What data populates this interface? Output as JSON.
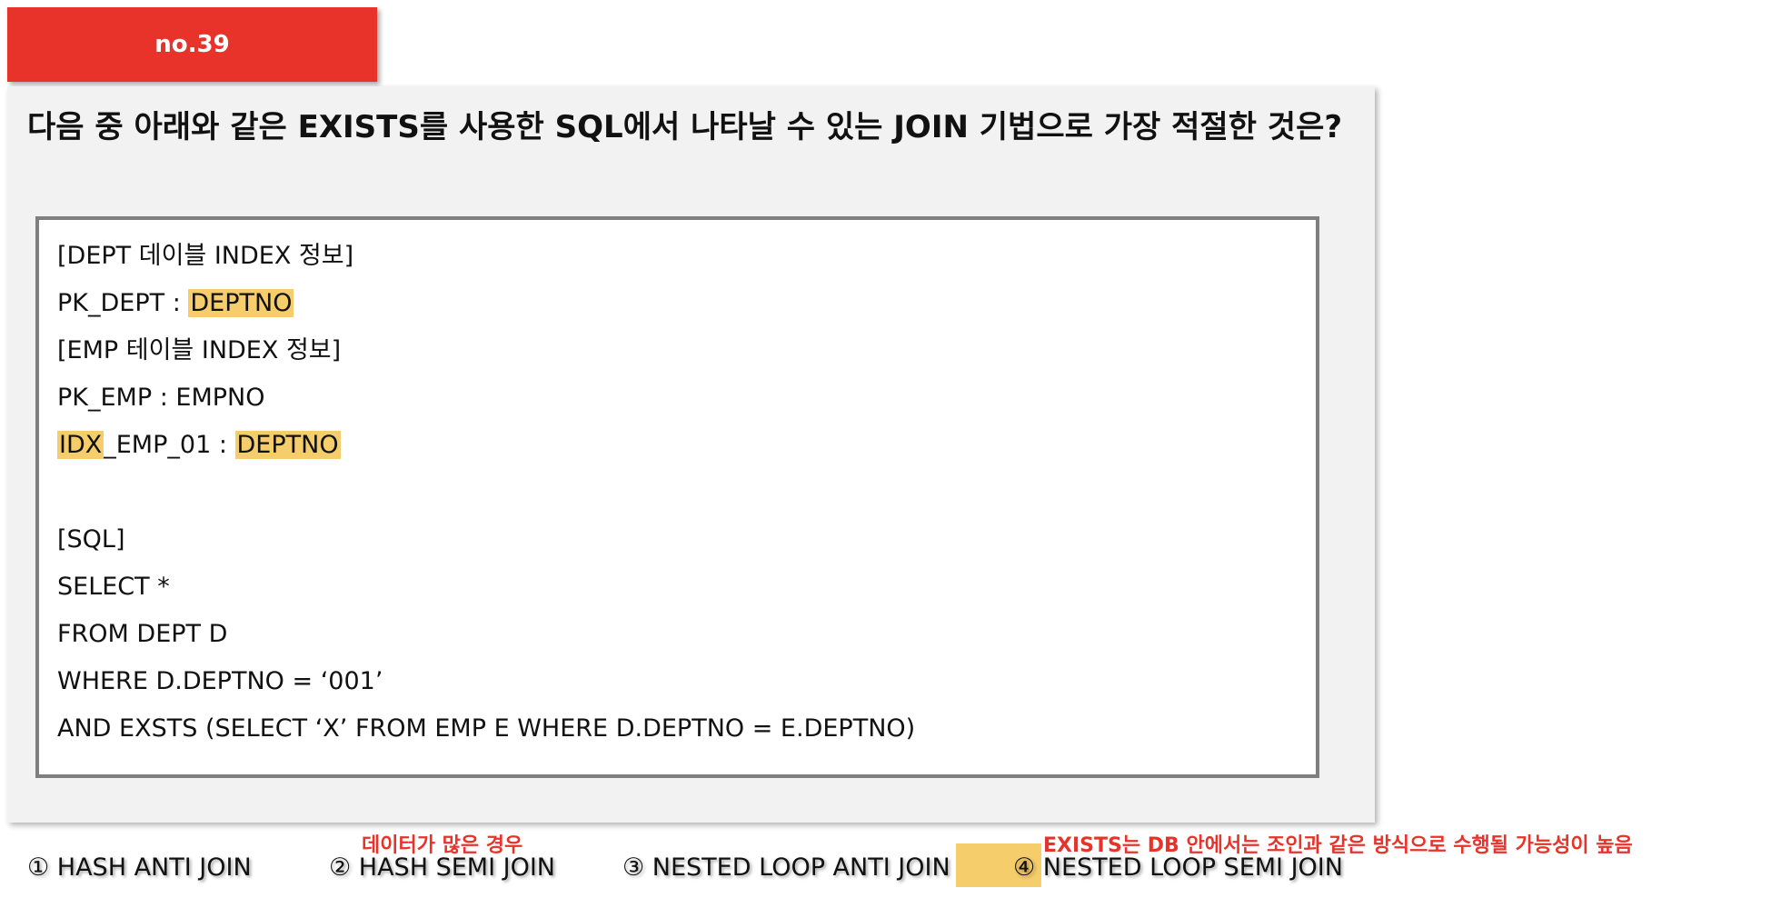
{
  "badge": {
    "label": "no.39"
  },
  "question": {
    "text": "다음 중 아래와 같은 EXISTS를 사용한 SQL에서 나타날 수 있는 JOIN 기법으로 가장 적절한 것은?"
  },
  "code": {
    "line1": "[DEPT 데이블 INDEX 정보]",
    "line2_prefix": "PK_DEPT : ",
    "line2_highlight": "DEPTNO",
    "line3": "[EMP 테이블 INDEX 정보]",
    "line4": "PK_EMP : EMPNO",
    "line5_highlight1": "IDX",
    "line5_middle": "_EMP_01 : ",
    "line5_highlight2": "DEPTNO",
    "line6": "",
    "line7": "[SQL]",
    "line8": "SELECT *",
    "line9": "FROM DEPT D",
    "line10": "WHERE D.DEPTNO = ‘001’",
    "line11": "AND EXSTS (SELECT ‘X’ FROM EMP E WHERE D.DEPTNO = E.DEPTNO)"
  },
  "options": {
    "o1": "① HASH ANTI JOIN",
    "o2": "② HASH SEMI JOIN",
    "o3": "③ NESTED LOOP ANTI JOIN",
    "o4": "④ NESTED LOOP SEMI JOIN"
  },
  "notes": {
    "n1": "데이터가 많은 경우",
    "n2": "EXISTS는 DB 안에서는 조인과 같은 방식으로 수행될 가능성이 높음"
  },
  "colors": {
    "accent": "#e8332b",
    "highlight": "#f5cd6a",
    "card": "#f2f2f2",
    "border": "#7f7f7f"
  }
}
